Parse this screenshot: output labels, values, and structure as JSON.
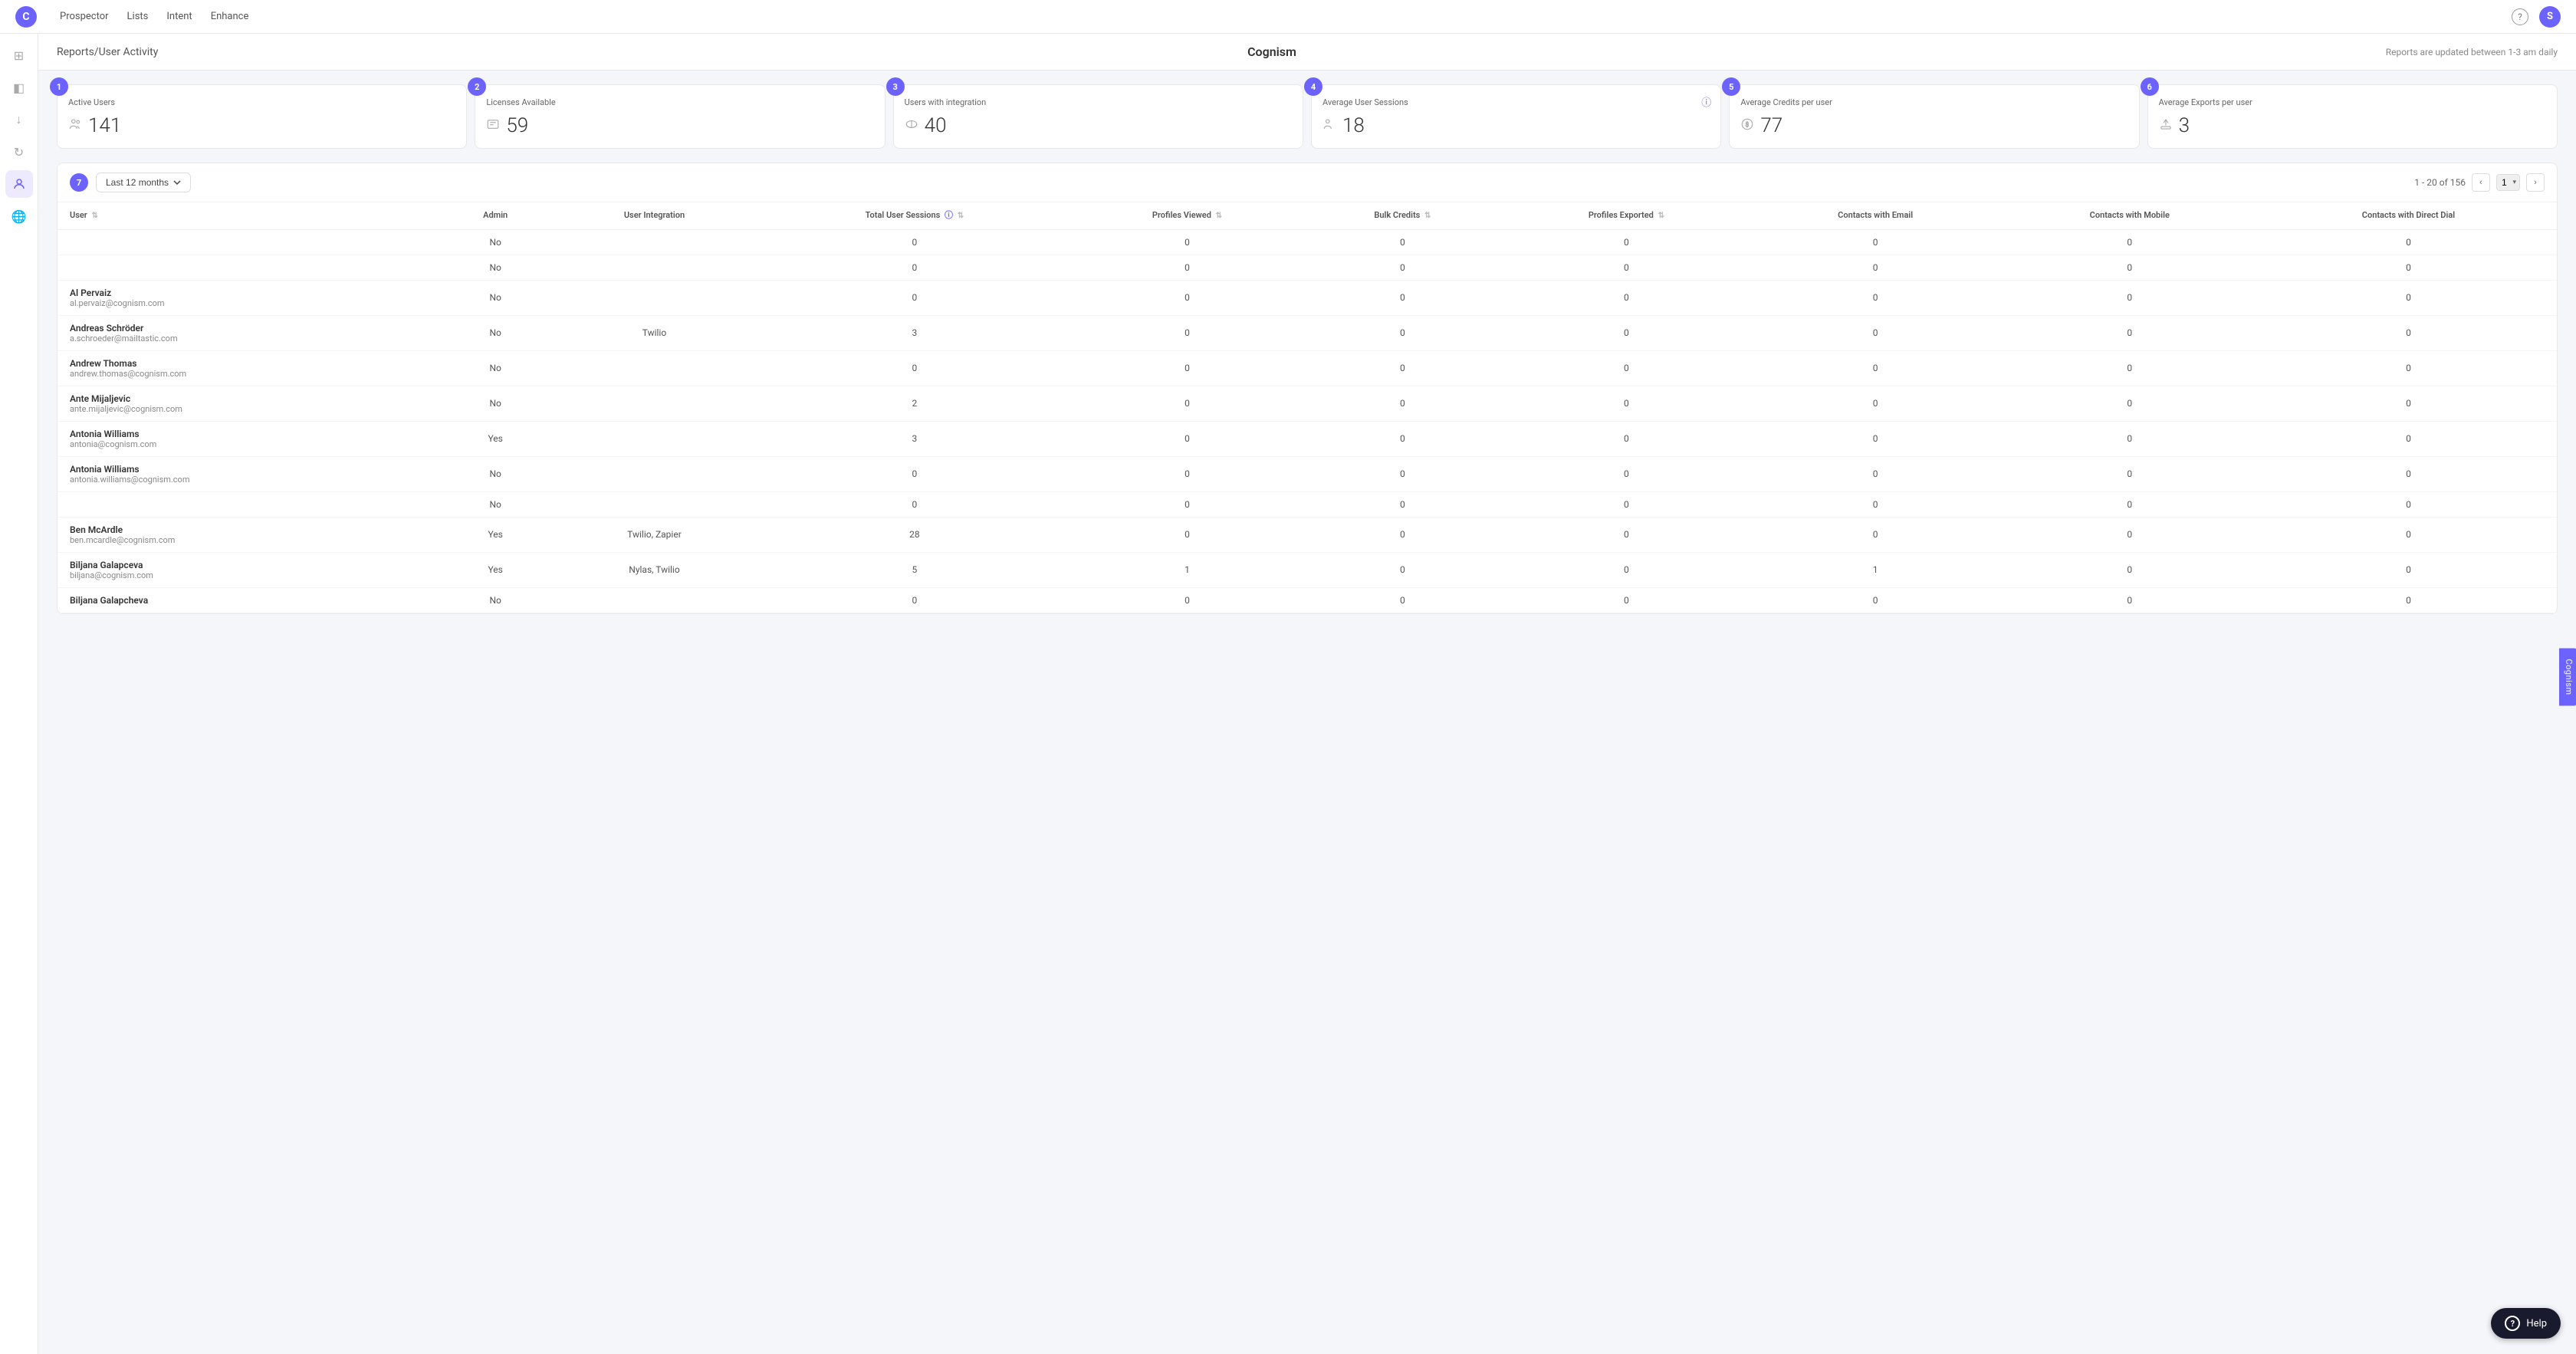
{
  "app": {
    "logo_letter": "C",
    "nav_links": [
      "Prospector",
      "Lists",
      "Intent",
      "Enhance"
    ],
    "help_label": "?",
    "avatar_letter": "S"
  },
  "sidebar": {
    "icons": [
      {
        "name": "grid-icon",
        "symbol": "⊞",
        "active": false
      },
      {
        "name": "layers-icon",
        "symbol": "◫",
        "active": false
      },
      {
        "name": "download-icon",
        "symbol": "↓",
        "active": false
      },
      {
        "name": "refresh-icon",
        "symbol": "↻",
        "active": false
      },
      {
        "name": "user-icon",
        "symbol": "👤",
        "active": true
      },
      {
        "name": "globe-icon",
        "symbol": "🌐",
        "active": false
      }
    ]
  },
  "header": {
    "title": "Reports/User Activity",
    "center": "Cognism",
    "right_note": "Reports are updated between 1-3 am daily"
  },
  "stats": [
    {
      "badge": "1",
      "label": "Active Users",
      "value": "141",
      "icon": "👥"
    },
    {
      "badge": "2",
      "label": "Licenses Available",
      "value": "59",
      "icon": "🗂"
    },
    {
      "badge": "3",
      "label": "Users with integration",
      "value": "40",
      "icon": "☁"
    },
    {
      "badge": "4",
      "label": "Average User Sessions",
      "value": "18",
      "icon": "👥",
      "info": true
    },
    {
      "badge": "5",
      "label": "Average Credits per user",
      "value": "77",
      "icon": "🪙"
    },
    {
      "badge": "6",
      "label": "Average Exports per user",
      "value": "3",
      "icon": "↑"
    }
  ],
  "table": {
    "badge": "7",
    "filter_label": "Last 12 months",
    "pagination_info": "1 - 20 of 156",
    "current_page": "1",
    "columns": {
      "user": "User",
      "admin": "Admin",
      "user_integration": "User Integration",
      "total_user_sessions": "Total User Sessions",
      "profiles_viewed": "Profiles Viewed",
      "bulk_credits": "Bulk Credits",
      "profiles_exported": "Profiles Exported",
      "contacts_with_email": "Contacts with Email",
      "contacts_with_mobile": "Contacts with Mobile",
      "contacts_with_direct_dial": "Contacts with Direct Dial"
    },
    "rows": [
      {
        "name": "",
        "email": "",
        "admin": "No",
        "integration": "",
        "sessions": 0,
        "profiles_viewed": 0,
        "bulk_credits": 0,
        "profiles_exported": 0,
        "contacts_email": 0,
        "contacts_mobile": 0,
        "contacts_direct": 0
      },
      {
        "name": "",
        "email": "",
        "admin": "No",
        "integration": "",
        "sessions": 0,
        "profiles_viewed": 0,
        "bulk_credits": 0,
        "profiles_exported": 0,
        "contacts_email": 0,
        "contacts_mobile": 0,
        "contacts_direct": 0
      },
      {
        "name": "Al Pervaiz",
        "email": "al.pervaiz@cognism.com",
        "admin": "No",
        "integration": "",
        "sessions": 0,
        "profiles_viewed": 0,
        "bulk_credits": 0,
        "profiles_exported": 0,
        "contacts_email": 0,
        "contacts_mobile": 0,
        "contacts_direct": 0
      },
      {
        "name": "Andreas Schröder",
        "email": "a.schroeder@mailtastic.com",
        "admin": "No",
        "integration": "Twilio",
        "sessions": 3,
        "profiles_viewed": 0,
        "bulk_credits": 0,
        "profiles_exported": 0,
        "contacts_email": 0,
        "contacts_mobile": 0,
        "contacts_direct": 0
      },
      {
        "name": "Andrew Thomas",
        "email": "andrew.thomas@cognism.com",
        "admin": "No",
        "integration": "",
        "sessions": 0,
        "profiles_viewed": 0,
        "bulk_credits": 0,
        "profiles_exported": 0,
        "contacts_email": 0,
        "contacts_mobile": 0,
        "contacts_direct": 0
      },
      {
        "name": "Ante Mijaljevic",
        "email": "ante.mijaljevic@cognism.com",
        "admin": "No",
        "integration": "",
        "sessions": 2,
        "profiles_viewed": 0,
        "bulk_credits": 0,
        "profiles_exported": 0,
        "contacts_email": 0,
        "contacts_mobile": 0,
        "contacts_direct": 0
      },
      {
        "name": "Antonia Williams",
        "email": "antonia@cognism.com",
        "admin": "Yes",
        "integration": "",
        "sessions": 3,
        "profiles_viewed": 0,
        "bulk_credits": 0,
        "profiles_exported": 0,
        "contacts_email": 0,
        "contacts_mobile": 0,
        "contacts_direct": 0
      },
      {
        "name": "Antonia Williams",
        "email": "antonia.williams@cognism.com",
        "admin": "No",
        "integration": "",
        "sessions": 0,
        "profiles_viewed": 0,
        "bulk_credits": 0,
        "profiles_exported": 0,
        "contacts_email": 0,
        "contacts_mobile": 0,
        "contacts_direct": 0
      },
      {
        "name": "",
        "email": "",
        "admin": "No",
        "integration": "",
        "sessions": 0,
        "profiles_viewed": 0,
        "bulk_credits": 0,
        "profiles_exported": 0,
        "contacts_email": 0,
        "contacts_mobile": 0,
        "contacts_direct": 0
      },
      {
        "name": "Ben McArdle",
        "email": "ben.mcardle@cognism.com",
        "admin": "Yes",
        "integration": "Twilio, Zapier",
        "sessions": 28,
        "profiles_viewed": 0,
        "bulk_credits": 0,
        "profiles_exported": 0,
        "contacts_email": 0,
        "contacts_mobile": 0,
        "contacts_direct": 0
      },
      {
        "name": "Biljana Galapceva",
        "email": "biljana@cognism.com",
        "admin": "Yes",
        "integration": "Nylas, Twilio",
        "sessions": 5,
        "profiles_viewed": 1,
        "bulk_credits": 0,
        "profiles_exported": 0,
        "contacts_email": 1,
        "contacts_mobile": 0,
        "contacts_direct": 0
      },
      {
        "name": "Biljana Galapcheva",
        "email": "",
        "admin": "No",
        "integration": "",
        "sessions": 0,
        "profiles_viewed": 0,
        "bulk_credits": 0,
        "profiles_exported": 0,
        "contacts_email": 0,
        "contacts_mobile": 0,
        "contacts_direct": 0
      }
    ]
  },
  "side_tab": "Cognism",
  "help_button": "Help"
}
